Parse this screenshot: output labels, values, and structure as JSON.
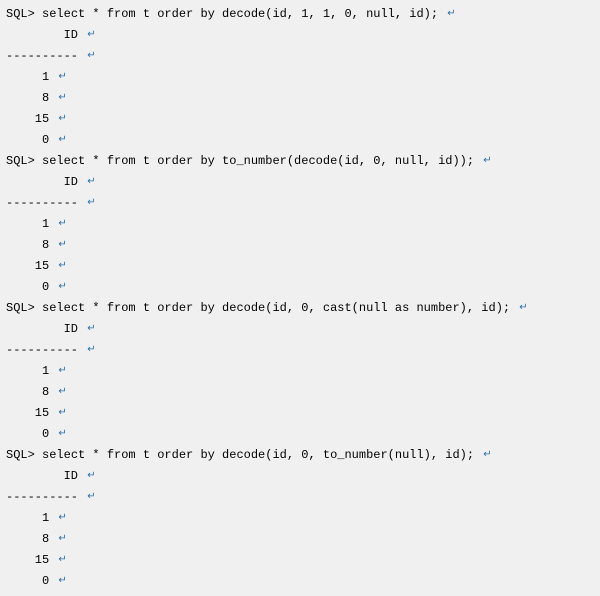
{
  "prompt": "SQL>",
  "marker": "↵",
  "column_header": "ID",
  "divider": "----------",
  "blocks": [
    {
      "query": "select * from t order by decode(id, 1, 1, 0, null, id);",
      "rows": [
        "1",
        "8",
        "15",
        "0"
      ]
    },
    {
      "query": "select * from t order by to_number(decode(id, 0, null, id));",
      "rows": [
        "1",
        "8",
        "15",
        "0"
      ]
    },
    {
      "query": "select * from t order by decode(id, 0, cast(null as number), id);",
      "rows": [
        "1",
        "8",
        "15",
        "0"
      ]
    },
    {
      "query": "select * from t order by decode(id, 0, to_number(null), id);",
      "rows": [
        "1",
        "8",
        "15",
        "0"
      ]
    }
  ]
}
